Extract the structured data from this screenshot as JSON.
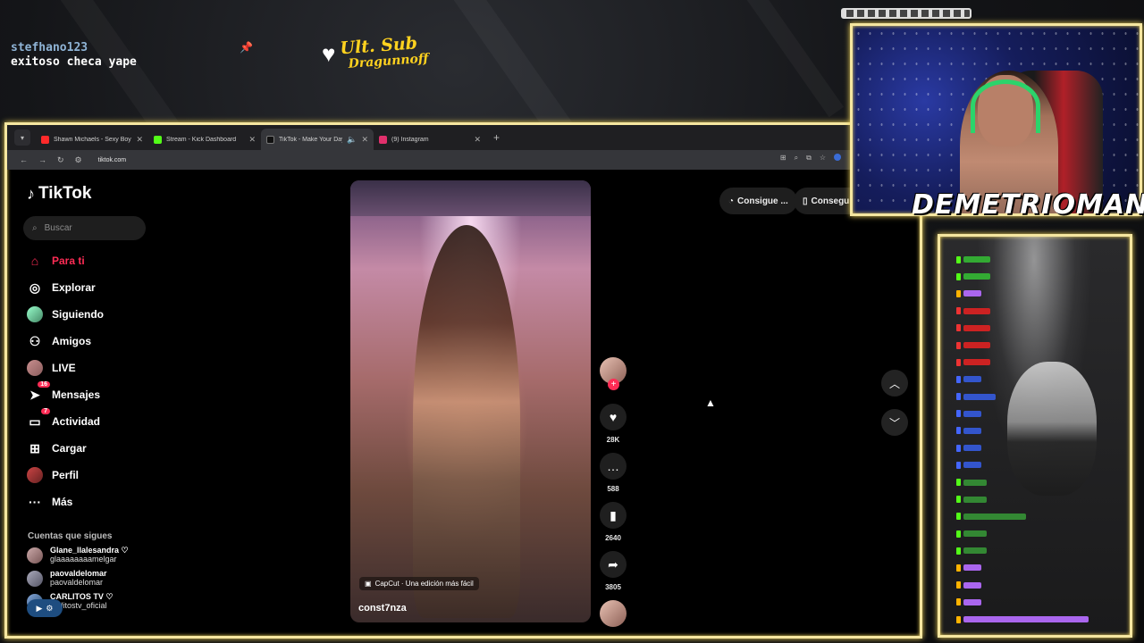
{
  "overlay": {
    "chat_user": "stefhano123",
    "chat_message": "exitoso checa yape",
    "sub_label": "Ult. Sub",
    "sub_name": "Dragunnoff",
    "streamer_name": "DEMETRIOMAN"
  },
  "browser": {
    "tabs": [
      {
        "title": "Shawn Michaels - Sexy Boy (C...",
        "color": "#ff2a2a"
      },
      {
        "title": "Stream - Kick Dashboard",
        "color": "#53fc18"
      },
      {
        "title": "TikTok - Make Your Day",
        "color": "#111111"
      },
      {
        "title": "(9) Instagram",
        "color": "#e1306c"
      }
    ],
    "url": "tiktok.com"
  },
  "tiktok": {
    "logo": "TikTok",
    "search_placeholder": "Buscar",
    "nav": [
      {
        "label": "Para ti",
        "icon": "home-icon",
        "active": true
      },
      {
        "label": "Explorar",
        "icon": "compass-icon"
      },
      {
        "label": "Siguiendo",
        "icon": "following-avatar-icon"
      },
      {
        "label": "Amigos",
        "icon": "friends-icon"
      },
      {
        "label": "LIVE",
        "icon": "live-avatar-icon"
      },
      {
        "label": "Mensajes",
        "icon": "messages-icon",
        "badge": "16"
      },
      {
        "label": "Actividad",
        "icon": "activity-icon",
        "badge": "7"
      },
      {
        "label": "Cargar",
        "icon": "upload-icon"
      },
      {
        "label": "Perfil",
        "icon": "profile-avatar-icon"
      },
      {
        "label": "Más",
        "icon": "more-icon"
      }
    ],
    "following_title": "Cuentas que sigues",
    "following": [
      {
        "name": "Glane_llalesandra ♡",
        "handle": "glaaaaaaaamelgar"
      },
      {
        "name": "paovaldelomar",
        "handle": "paovaldelomar"
      },
      {
        "name": "CARLITOS TV ♡",
        "handle": "carlitostv_oficial"
      }
    ],
    "get_app_1": "Consigue ...",
    "get_app_2": "Consegui",
    "video": {
      "capcut": "CapCut · Una edición más fácil",
      "author": "const7nza"
    },
    "actions": {
      "likes": "28K",
      "comments": "588",
      "saves": "2640",
      "shares": "3805"
    }
  }
}
